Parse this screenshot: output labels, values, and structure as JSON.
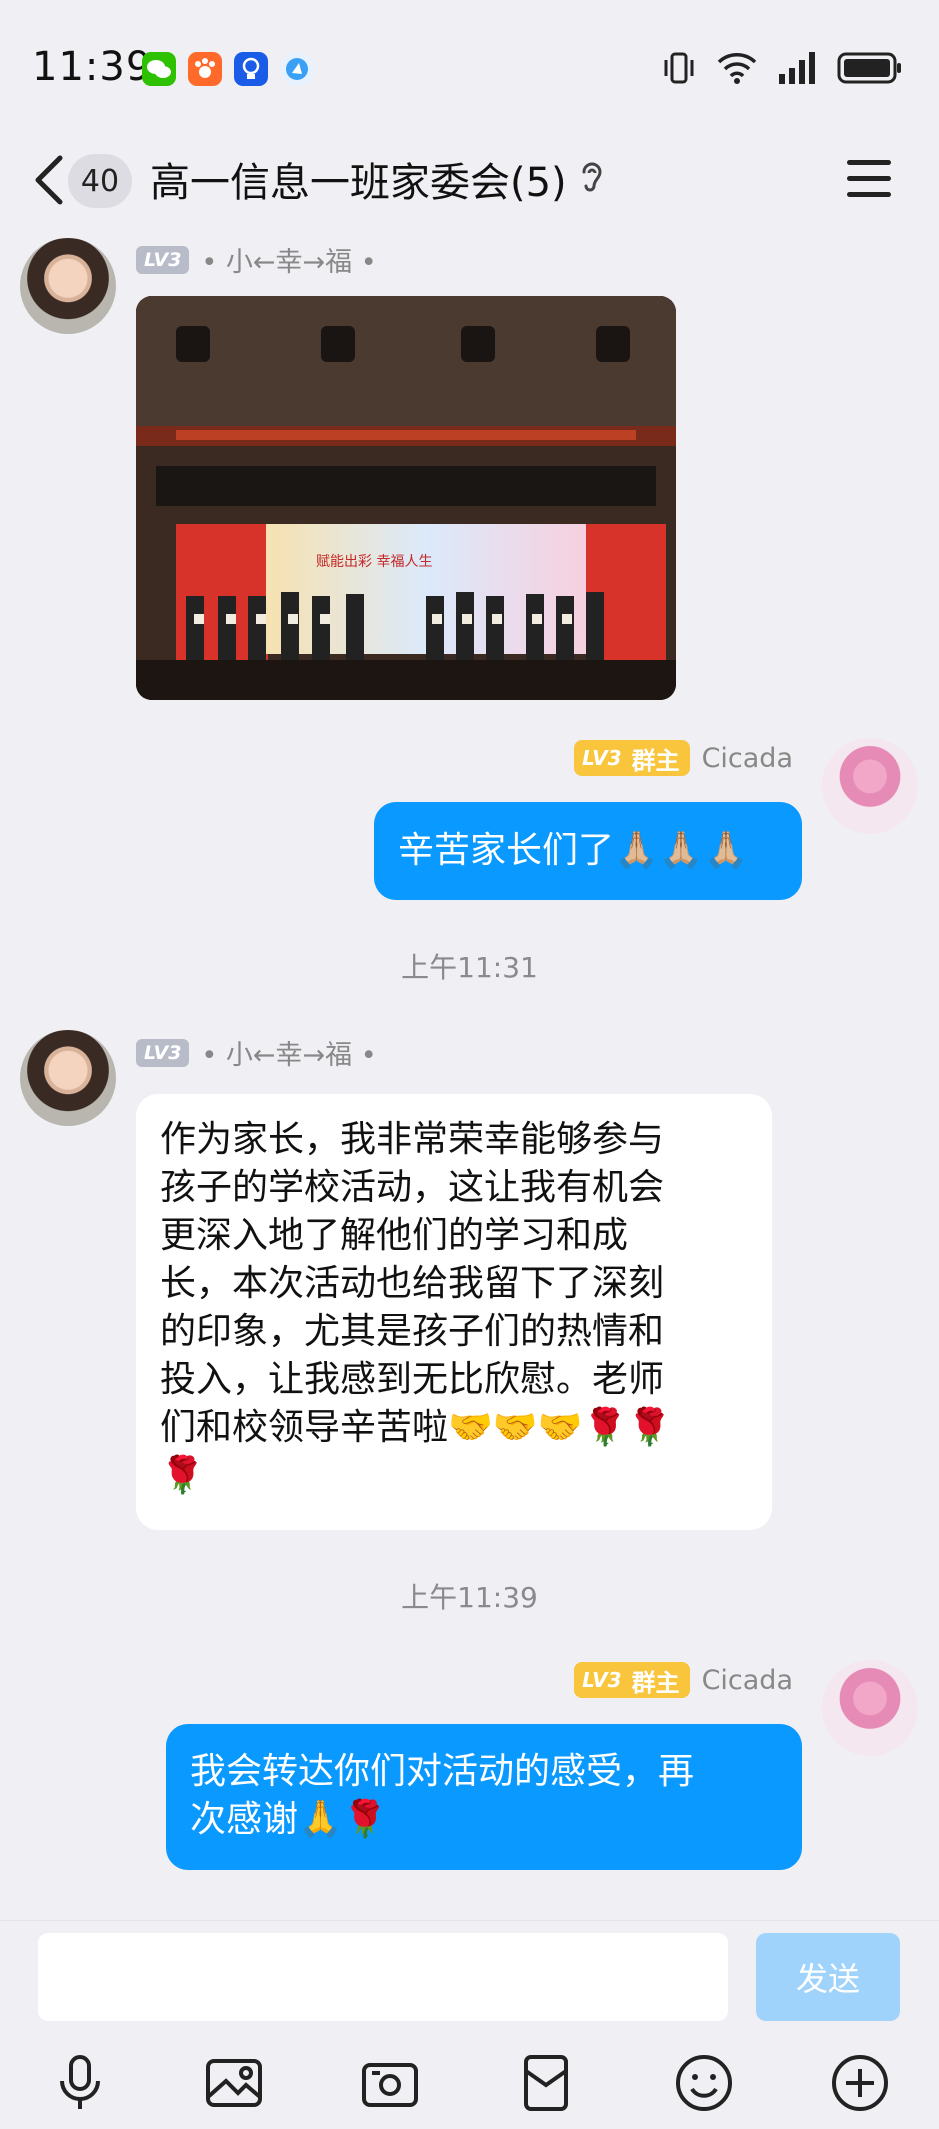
{
  "status_bar": {
    "time": "11:39",
    "apps": [
      "wechat-icon",
      "paw-app-icon",
      "bulb-app-icon",
      "browser-app-icon"
    ],
    "indicators": [
      "vibrate-icon",
      "wifi-icon",
      "signal-icon",
      "battery-icon"
    ]
  },
  "header": {
    "back_badge": "40",
    "title": "高一信息一班家委会(5)"
  },
  "messages": [
    {
      "id": "m1",
      "side": "left",
      "level": "LV3",
      "sender": "• 小←幸→福 •",
      "type": "image",
      "image_desc": "stage-ceremony-photo",
      "banner_text": "赋能出彩 幸福人生"
    },
    {
      "id": "m2",
      "side": "right",
      "level": "LV3",
      "role": "群主",
      "sender": "Cicada",
      "type": "text",
      "text": "辛苦家长们了🙏🏼🙏🏼🙏🏼"
    },
    {
      "id": "t1",
      "type": "timestamp",
      "text": "上午11:31"
    },
    {
      "id": "m3",
      "side": "left",
      "level": "LV3",
      "sender": "• 小←幸→福 •",
      "type": "text",
      "lines": [
        "作为家长，我非常荣幸能够参与",
        "孩子的学校活动，这让我有机会",
        "更深入地了解他们的学习和成",
        "长，本次活动也给我留下了深刻",
        "的印象，尤其是孩子们的热情和",
        "投入，让我感到无比欣慰。老师",
        "们和校领导辛苦啦🤝🤝🤝🌹🌹",
        "🌹"
      ]
    },
    {
      "id": "t2",
      "type": "timestamp",
      "text": "上午11:39"
    },
    {
      "id": "m4",
      "side": "right",
      "level": "LV3",
      "role": "群主",
      "sender": "Cicada",
      "type": "text",
      "lines": [
        "我会转达你们对活动的感受，再",
        "次感谢🙏🌹"
      ]
    }
  ],
  "input": {
    "value": "",
    "send_label": "发送"
  },
  "toolbar": {
    "items": [
      "voice-icon",
      "image-icon",
      "camera-icon",
      "red-packet-icon",
      "emoji-icon",
      "plus-icon"
    ]
  }
}
